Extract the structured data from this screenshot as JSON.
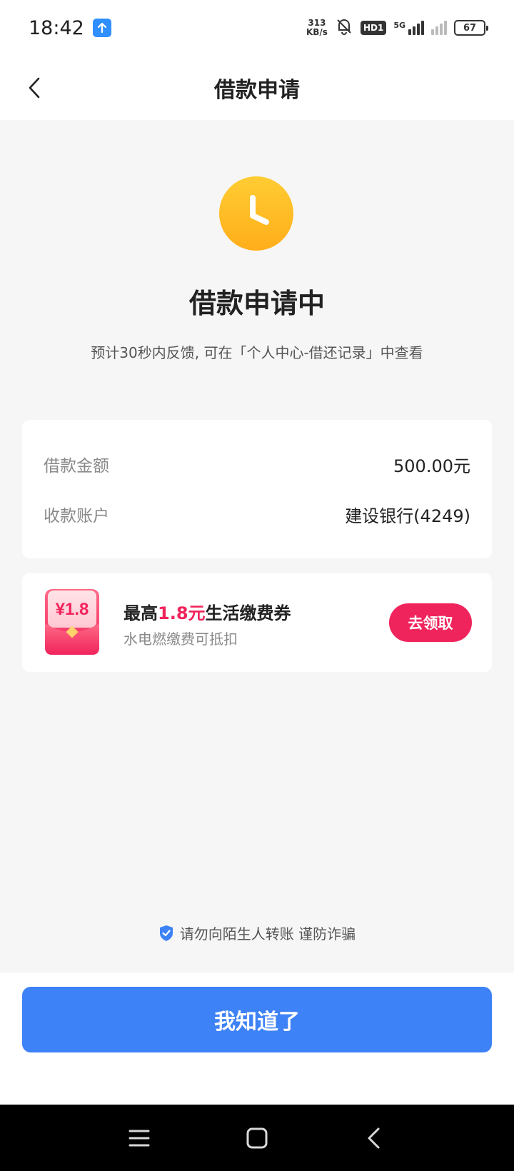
{
  "status_bar": {
    "time": "18:42",
    "net_speed_value": "313",
    "net_speed_unit": "KB/s",
    "hd_label": "HD1",
    "network_label": "5G",
    "battery": "67"
  },
  "nav": {
    "title": "借款申请"
  },
  "status": {
    "title": "借款申请中",
    "description": "预计30秒内反馈, 可在「个人中心-借还记录」中查看"
  },
  "loan_info": {
    "rows": [
      {
        "label": "借款金额",
        "value": "500.00元"
      },
      {
        "label": "收款账户",
        "value": "建设银行(4249)"
      }
    ]
  },
  "coupon": {
    "badge_amount": "¥1.8",
    "title_prefix": "最高",
    "title_highlight": "1.8元",
    "title_suffix": "生活缴费券",
    "subtitle": "水电燃缴费可抵扣",
    "button_label": "去领取",
    "colors": {
      "accent": "#f0245c"
    }
  },
  "safety_tip": "请勿向陌生人转账 谨防诈骗",
  "confirm_button": "我知道了",
  "colors": {
    "primary": "#3d82f6",
    "pending_icon": "#ffb020"
  },
  "icons": {
    "back": "chevron-left-icon",
    "status": "clock-icon",
    "safety": "shield-check-icon",
    "sys_menu": "menu-icon",
    "sys_home": "square-home-icon",
    "sys_back": "triangle-back-icon"
  }
}
